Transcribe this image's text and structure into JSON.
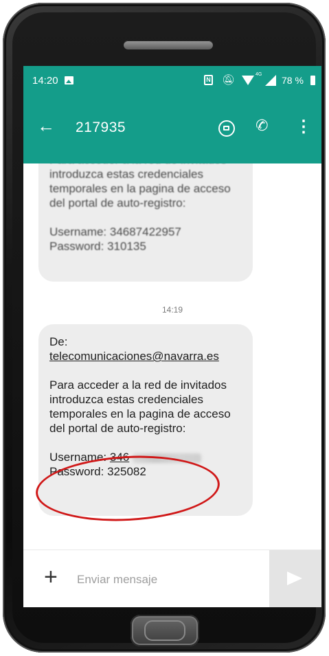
{
  "status_bar": {
    "time": "14:20",
    "battery": "78 %",
    "signal_label": "4G"
  },
  "app_bar": {
    "title": "217935"
  },
  "messages": [
    {
      "lines_intro": "Para acceder a la red de invitados introduzca estas credenciales temporales en la pagina de acceso del portal de auto-registro:",
      "username_line": "Username: 34687422957",
      "password_line": "Password: 310135"
    }
  ],
  "timestamp": "14:19",
  "message_2": {
    "from_label": "De:",
    "email": "telecomunicaciones@navarra.es",
    "body": "Para acceder a la red de invitados introduzca estas credenciales temporales en la pagina de acceso del portal de auto-registro:",
    "username_label": "Username: ",
    "username_value": "346",
    "password_line": "Password: 325082"
  },
  "composer": {
    "placeholder": "Enviar mensaje"
  },
  "colors": {
    "accent": "#149d8a",
    "bubble": "#ededed",
    "highlight": "#d01818"
  },
  "icons": [
    "image-icon",
    "nfc-icon",
    "mute-icon",
    "wifi-icon",
    "signal-icon",
    "battery-icon",
    "back-arrow-icon",
    "video-call-icon",
    "phone-icon",
    "more-icon",
    "plus-icon",
    "send-icon"
  ]
}
